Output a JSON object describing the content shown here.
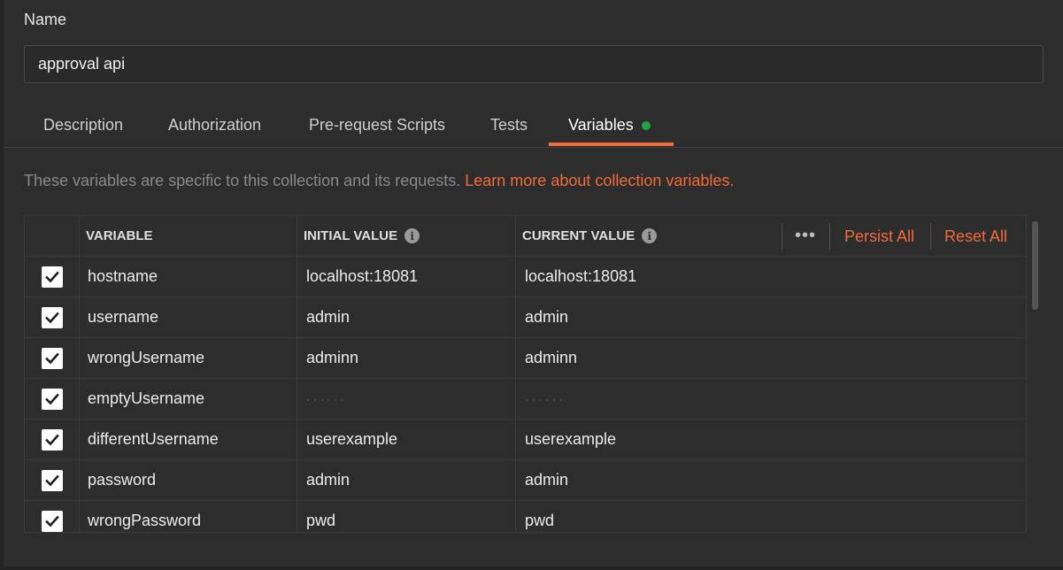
{
  "name_label": "Name",
  "name_value": "approval api",
  "tabs": [
    {
      "label": "Description"
    },
    {
      "label": "Authorization"
    },
    {
      "label": "Pre-request Scripts"
    },
    {
      "label": "Tests"
    },
    {
      "label": "Variables"
    }
  ],
  "active_tab": "Variables",
  "info": {
    "text": "These variables are specific to this collection and its requests.",
    "link": "Learn more about collection variables."
  },
  "table": {
    "headers": {
      "variable": "VARIABLE",
      "initial": "INITIAL VALUE",
      "current": "CURRENT VALUE"
    },
    "actions": {
      "more": "•••",
      "persist_all": "Persist All",
      "reset_all": "Reset All"
    },
    "rows": [
      {
        "checked": true,
        "variable": "hostname",
        "initial": "localhost:18081",
        "current": "localhost:18081"
      },
      {
        "checked": true,
        "variable": "username",
        "initial": "admin",
        "current": "admin"
      },
      {
        "checked": true,
        "variable": "wrongUsername",
        "initial": "adminn",
        "current": "adminn"
      },
      {
        "checked": true,
        "variable": "emptyUsername",
        "initial": "",
        "current": ""
      },
      {
        "checked": true,
        "variable": "differentUsername",
        "initial": "userexample",
        "current": "userexample"
      },
      {
        "checked": true,
        "variable": "password",
        "initial": "admin",
        "current": "admin"
      },
      {
        "checked": true,
        "variable": "wrongPassword",
        "initial": "pwd",
        "current": "pwd"
      }
    ]
  },
  "colors": {
    "accent": "#f26b3a",
    "status_dot": "#24a148",
    "background": "#2d2d2d"
  }
}
